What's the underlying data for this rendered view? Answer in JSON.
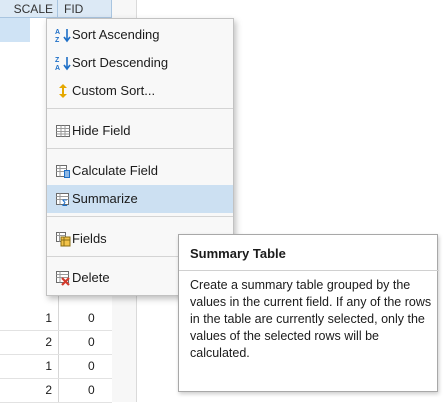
{
  "table": {
    "columns": [
      "SCALE",
      "FID"
    ],
    "rows": [
      [
        "1",
        "0"
      ],
      [
        "2",
        "0"
      ],
      [
        "1",
        "0"
      ],
      [
        "2",
        "0"
      ]
    ]
  },
  "context_menu": {
    "items": [
      {
        "label": "Sort Ascending",
        "icon": "sort-ascending-icon",
        "highlighted": false
      },
      {
        "label": "Sort Descending",
        "icon": "sort-descending-icon",
        "highlighted": false
      },
      {
        "label": "Custom Sort...",
        "icon": "custom-sort-icon",
        "highlighted": false
      },
      {
        "label": "Hide Field",
        "icon": "hide-field-icon",
        "highlighted": false
      },
      {
        "label": "Calculate Field",
        "icon": "calculate-field-icon",
        "highlighted": false
      },
      {
        "label": "Summarize",
        "icon": "summarize-icon",
        "highlighted": true
      },
      {
        "label": "Fields",
        "icon": "fields-icon",
        "highlighted": false
      },
      {
        "label": "Delete",
        "icon": "delete-icon",
        "highlighted": false
      }
    ]
  },
  "tooltip": {
    "title": "Summary Table",
    "body": "Create a summary table grouped by the values in the current field. If any of the rows in the table are currently selected, only the values of the selected rows will be calculated."
  },
  "colors": {
    "highlight": "#cce0f2",
    "accent_blue": "#1e6fc7",
    "accent_red": "#d23a2c"
  }
}
